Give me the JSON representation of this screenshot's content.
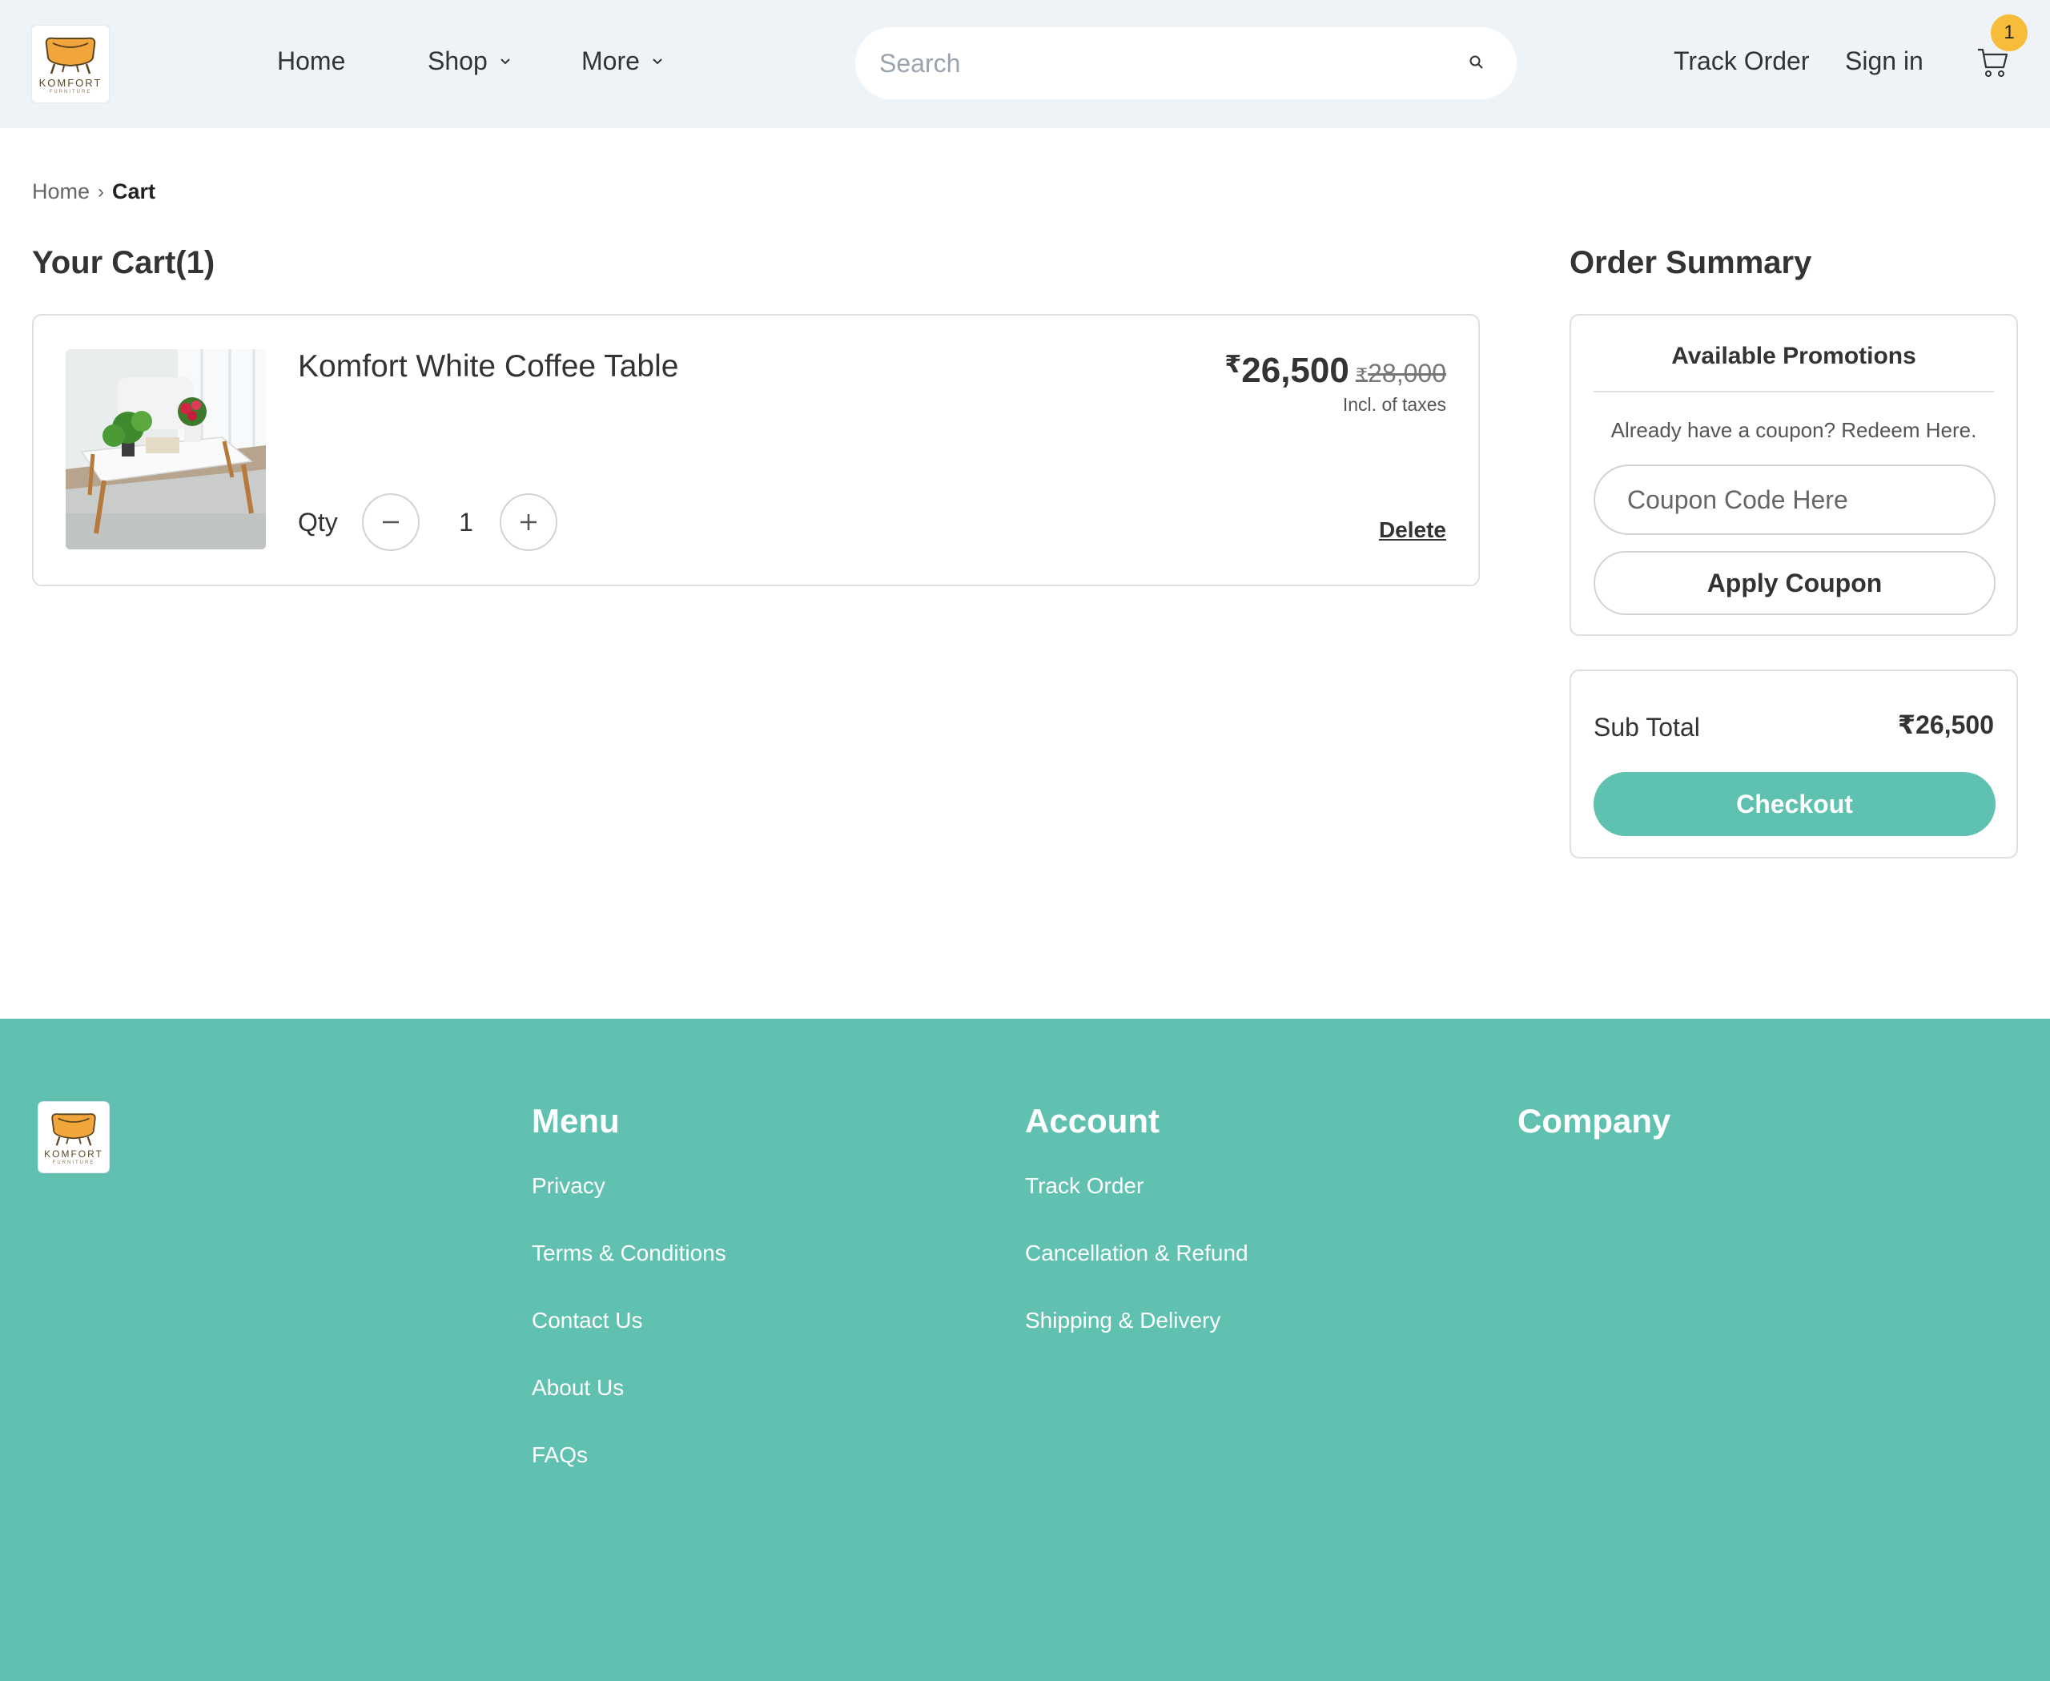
{
  "brand": {
    "name": "KOMFORT",
    "tagline": "FURNITURE"
  },
  "nav": {
    "home": "Home",
    "shop": "Shop",
    "more": "More"
  },
  "search": {
    "placeholder": "Search"
  },
  "header_links": {
    "track_order": "Track Order",
    "sign_in": "Sign in"
  },
  "cart_badge": "1",
  "breadcrumb": {
    "home": "Home",
    "separator": "›",
    "current": "Cart"
  },
  "cart": {
    "title": "Your Cart(1)",
    "item": {
      "name": "Komfort White Coffee Table",
      "currency_symbol": "₹",
      "price": "26,500",
      "original_price": "28,000",
      "tax_note": "Incl. of taxes",
      "qty_label": "Qty",
      "qty": "1",
      "delete_label": "Delete"
    }
  },
  "summary": {
    "title": "Order Summary",
    "promotions_title": "Available Promotions",
    "coupon_hint": "Already have a coupon? Redeem Here.",
    "coupon_placeholder": "Coupon Code Here",
    "apply_label": "Apply Coupon",
    "subtotal_label": "Sub Total",
    "subtotal_value": "₹26,500",
    "checkout_label": "Checkout"
  },
  "footer": {
    "menu": {
      "heading": "Menu",
      "links": [
        "Privacy",
        "Terms & Conditions",
        "Contact Us",
        "About Us",
        "FAQs"
      ]
    },
    "account": {
      "heading": "Account",
      "links": [
        "Track Order",
        "Cancellation & Refund",
        "Shipping & Delivery"
      ]
    },
    "company": {
      "heading": "Company"
    }
  },
  "colors": {
    "accent": "#5fc1b0",
    "footer_bg": "#61c1b0",
    "header_bg": "#eef3f7",
    "badge": "#f7bd3a"
  }
}
